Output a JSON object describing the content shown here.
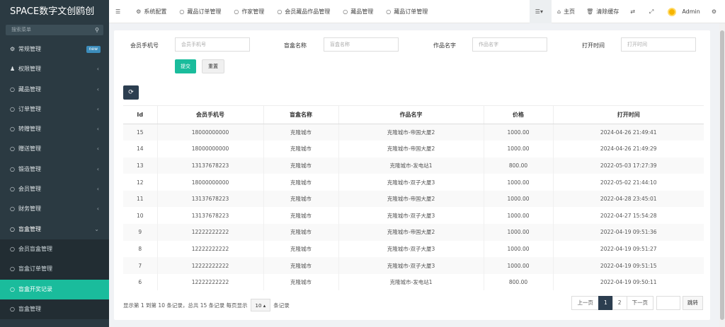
{
  "brand": "SPACE数字文创鸥创",
  "sidebar": {
    "search_placeholder": "搜索菜单",
    "search_icon": "search-icon",
    "items": [
      {
        "label": "常规管理",
        "icon": "gear-icon",
        "badge": "new"
      },
      {
        "label": "权限管理",
        "icon": "users-icon"
      },
      {
        "label": "藏品管理",
        "icon": "circle-icon"
      },
      {
        "label": "订单管理",
        "icon": "circle-icon"
      },
      {
        "label": "转赠管理",
        "icon": "circle-icon"
      },
      {
        "label": "赠送管理",
        "icon": "circle-icon"
      },
      {
        "label": "锻造管理",
        "icon": "circle-icon"
      },
      {
        "label": "会员管理",
        "icon": "circle-icon"
      },
      {
        "label": "财务管理",
        "icon": "circle-icon"
      },
      {
        "label": "盲盒管理",
        "icon": "circle-icon"
      }
    ],
    "sub_items": [
      {
        "label": "会员盲盒管理"
      },
      {
        "label": "盲盒订单管理"
      },
      {
        "label": "盲盒开奖记录"
      },
      {
        "label": "盲盒管理"
      }
    ]
  },
  "topbar": {
    "tabs": [
      {
        "label": "系统配置",
        "icon": "gear-icon"
      },
      {
        "label": "藏品订单管理",
        "icon": "circle-icon"
      },
      {
        "label": "作家管理",
        "icon": "circle-icon"
      },
      {
        "label": "会员藏品作品管理",
        "icon": "circle-icon"
      },
      {
        "label": "藏品管理",
        "icon": "circle-icon"
      },
      {
        "label": "藏品订单管理",
        "icon": "circle-icon"
      }
    ],
    "home": "主页",
    "clear_cache": "清除缓存",
    "user": "Admin"
  },
  "filters": {
    "phone_label": "会员手机号",
    "phone_placeholder": "会员手机号",
    "box_label": "盲盒名称",
    "box_placeholder": "盲盒名称",
    "work_label": "作品名字",
    "work_placeholder": "作品名字",
    "time_label": "打开时间",
    "time_placeholder": "打开时间",
    "submit": "提交",
    "reset": "重置"
  },
  "table": {
    "headers": [
      "Id",
      "会员手机号",
      "盲盒名称",
      "作品名字",
      "价格",
      "打开时间"
    ],
    "rows": [
      [
        "15",
        "18000000000",
        "克隆城市",
        "克隆城市-帝国大厦2",
        "1000.00",
        "2024-04-26 21:49:41"
      ],
      [
        "14",
        "18000000000",
        "克隆城市",
        "克隆城市-帝国大厦2",
        "1000.00",
        "2024-04-26 21:49:29"
      ],
      [
        "13",
        "13137678223",
        "克隆城市",
        "克隆城市-发电站1",
        "800.00",
        "2022-05-03 17:27:39"
      ],
      [
        "12",
        "18000000000",
        "克隆城市",
        "克隆城市-双子大厦3",
        "1000.00",
        "2022-05-02 21:44:10"
      ],
      [
        "11",
        "13137678223",
        "克隆城市",
        "克隆城市-帝国大厦2",
        "1000.00",
        "2022-04-28 23:45:01"
      ],
      [
        "10",
        "13137678223",
        "克隆城市",
        "克隆城市-双子大厦3",
        "1000.00",
        "2022-04-27 15:54:28"
      ],
      [
        "9",
        "12222222222",
        "克隆城市",
        "克隆城市-帝国大厦2",
        "1000.00",
        "2022-04-19 09:51:36"
      ],
      [
        "8",
        "12222222222",
        "克隆城市",
        "克隆城市-双子大厦3",
        "1000.00",
        "2022-04-19 09:51:27"
      ],
      [
        "7",
        "12222222222",
        "克隆城市",
        "克隆城市-双子大厦3",
        "1000.00",
        "2022-04-19 09:51:15"
      ],
      [
        "6",
        "12222222222",
        "克隆城市",
        "克隆城市-发电站1",
        "800.00",
        "2022-04-19 09:50:11"
      ]
    ]
  },
  "pager": {
    "info_prefix": "显示第 1 到第 10 条记录，总共 15 条记录 每页显示",
    "page_size": "10",
    "info_suffix": "条记录",
    "prev": "上一页",
    "pages": [
      "1",
      "2"
    ],
    "next": "下一页",
    "jump": "跳转"
  },
  "colors": {
    "sidebar_bg": "#2b3a42",
    "accent": "#1abc9c",
    "dark_btn": "#2c3e50"
  }
}
